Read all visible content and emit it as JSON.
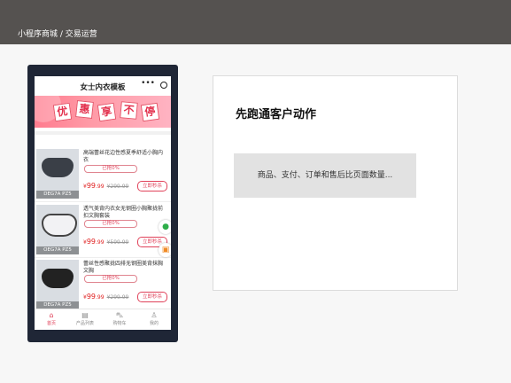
{
  "breadcrumb": "小程序商城 / 交易运营",
  "phone": {
    "title": "女士内衣模板",
    "banner_chars": [
      "优",
      "惠",
      "享",
      "不",
      "停"
    ],
    "products": [
      {
        "name": "高端蕾丝花边性感夏季舒适小胸内衣",
        "sold": "已抢0%",
        "price_symbol": "¥",
        "price_int": "99",
        "price_dec": ".99",
        "old_price": "¥299.99",
        "buy": "立即秒杀",
        "thumb_caption": "DEG7A PZ5"
      },
      {
        "name": "透气美背内衣女无钢圈小胸聚拢前扣文胸套装",
        "sold": "已抢0%",
        "price_symbol": "¥",
        "price_int": "99",
        "price_dec": ".99",
        "old_price": "¥599.99",
        "buy": "立即秒杀",
        "thumb_caption": "OEG7A PZ5"
      },
      {
        "name": "蕾丝性感聚拢四排无钢圈美背抹胸文胸",
        "sold": "已抢0%",
        "price_symbol": "¥",
        "price_int": "99",
        "price_dec": ".99",
        "old_price": "¥299.99",
        "buy": "立即秒杀",
        "thumb_caption": "DEG7A PZ5"
      }
    ],
    "tabs": [
      {
        "icon": "home-icon",
        "label": "首页"
      },
      {
        "icon": "product-list-icon",
        "label": "产品列表"
      },
      {
        "icon": "cart-icon",
        "label": "购物车"
      },
      {
        "icon": "user-icon",
        "label": "我的"
      }
    ],
    "accent": "#e0425a"
  },
  "card": {
    "heading": "先跑通客户动作",
    "description": "商品、支付、订单和售后比页面数量..."
  }
}
